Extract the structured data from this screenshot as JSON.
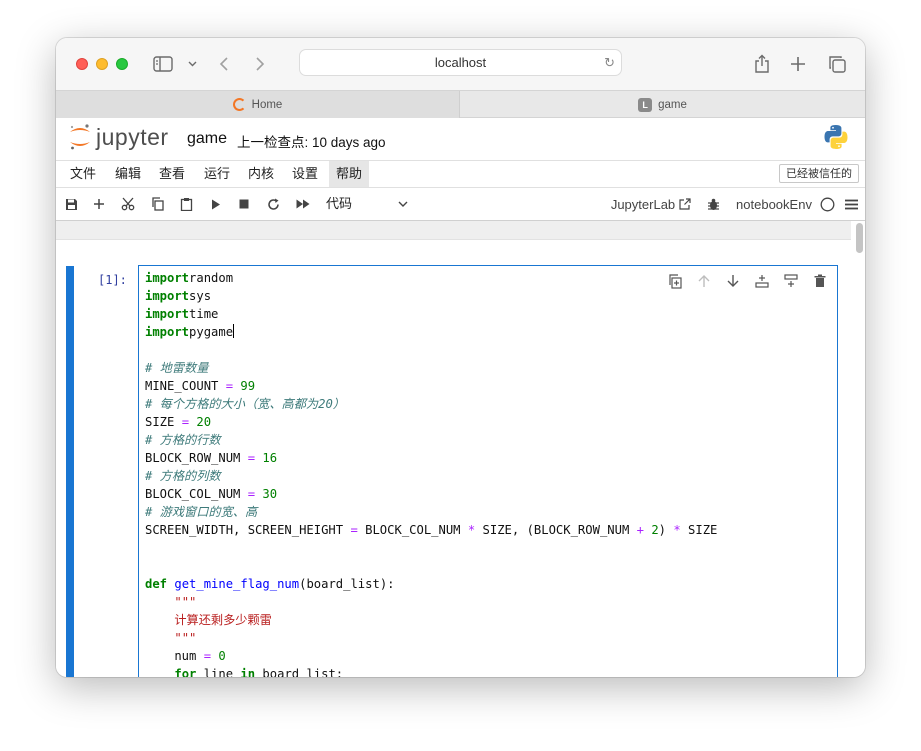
{
  "browser": {
    "address": "localhost",
    "tabs": [
      {
        "label": "Home"
      },
      {
        "label": "game"
      }
    ]
  },
  "header": {
    "logo_text": "jupyter",
    "notebook_name": "game",
    "checkpoint": "上一检查点: 10 days ago"
  },
  "menu": {
    "items": [
      "文件",
      "编辑",
      "查看",
      "运行",
      "内核",
      "设置",
      "帮助"
    ],
    "trusted_label": "已经被信任的"
  },
  "nb_toolbar": {
    "cell_type": "代码",
    "jupyterlab_label": "JupyterLab",
    "kernel_name": "notebookEnv"
  },
  "cell": {
    "prompt": "[1]:",
    "code_lines": [
      [
        [
          "k",
          "import"
        ],
        [
          "",
          "random"
        ]
      ],
      [
        [
          "k",
          "import"
        ],
        [
          "",
          "sys"
        ]
      ],
      [
        [
          "k",
          "import"
        ],
        [
          "",
          "time"
        ]
      ],
      [
        [
          "k",
          "import"
        ],
        [
          "",
          "pygame"
        ],
        [
          "cursor",
          ""
        ]
      ],
      [],
      [
        [
          "c",
          "# 地雷数量"
        ]
      ],
      [
        [
          "",
          "MINE_COUNT "
        ],
        [
          "o",
          "="
        ],
        [
          "",
          " "
        ],
        [
          "n",
          "99"
        ]
      ],
      [
        [
          "c",
          "# 每个方格的大小（宽、高都为20）"
        ]
      ],
      [
        [
          "",
          "SIZE "
        ],
        [
          "o",
          "="
        ],
        [
          "",
          " "
        ],
        [
          "n",
          "20"
        ]
      ],
      [
        [
          "c",
          "# 方格的行数"
        ]
      ],
      [
        [
          "",
          "BLOCK_ROW_NUM "
        ],
        [
          "o",
          "="
        ],
        [
          "",
          " "
        ],
        [
          "n",
          "16"
        ]
      ],
      [
        [
          "c",
          "# 方格的列数"
        ]
      ],
      [
        [
          "",
          "BLOCK_COL_NUM "
        ],
        [
          "o",
          "="
        ],
        [
          "",
          " "
        ],
        [
          "n",
          "30"
        ]
      ],
      [
        [
          "c",
          "# 游戏窗口的宽、高"
        ]
      ],
      [
        [
          "",
          "SCREEN_WIDTH, SCREEN_HEIGHT "
        ],
        [
          "o",
          "="
        ],
        [
          "",
          " BLOCK_COL_NUM "
        ],
        [
          "o",
          "*"
        ],
        [
          "",
          " SIZE, (BLOCK_ROW_NUM "
        ],
        [
          "o",
          "+"
        ],
        [
          "",
          " "
        ],
        [
          "n",
          "2"
        ],
        [
          "",
          ") "
        ],
        [
          "o",
          "*"
        ],
        [
          "",
          " SIZE"
        ]
      ],
      [],
      [],
      [
        [
          "k",
          "def"
        ],
        [
          "",
          " "
        ],
        [
          "f",
          "get_mine_flag_num"
        ],
        [
          "",
          "(board_list):"
        ]
      ],
      [
        [
          "",
          "    "
        ],
        [
          "s",
          "\"\"\""
        ]
      ],
      [
        [
          "",
          "    "
        ],
        [
          "s",
          "计算还剩多少颗雷"
        ]
      ],
      [
        [
          "",
          "    "
        ],
        [
          "s",
          "\"\"\""
        ]
      ],
      [
        [
          "",
          "    num "
        ],
        [
          "o",
          "="
        ],
        [
          "",
          " "
        ],
        [
          "n",
          "0"
        ]
      ],
      [
        [
          "",
          "    "
        ],
        [
          "k",
          "for"
        ],
        [
          "",
          " line "
        ],
        [
          "k",
          "in"
        ],
        [
          "",
          " board_list:"
        ]
      ]
    ]
  }
}
